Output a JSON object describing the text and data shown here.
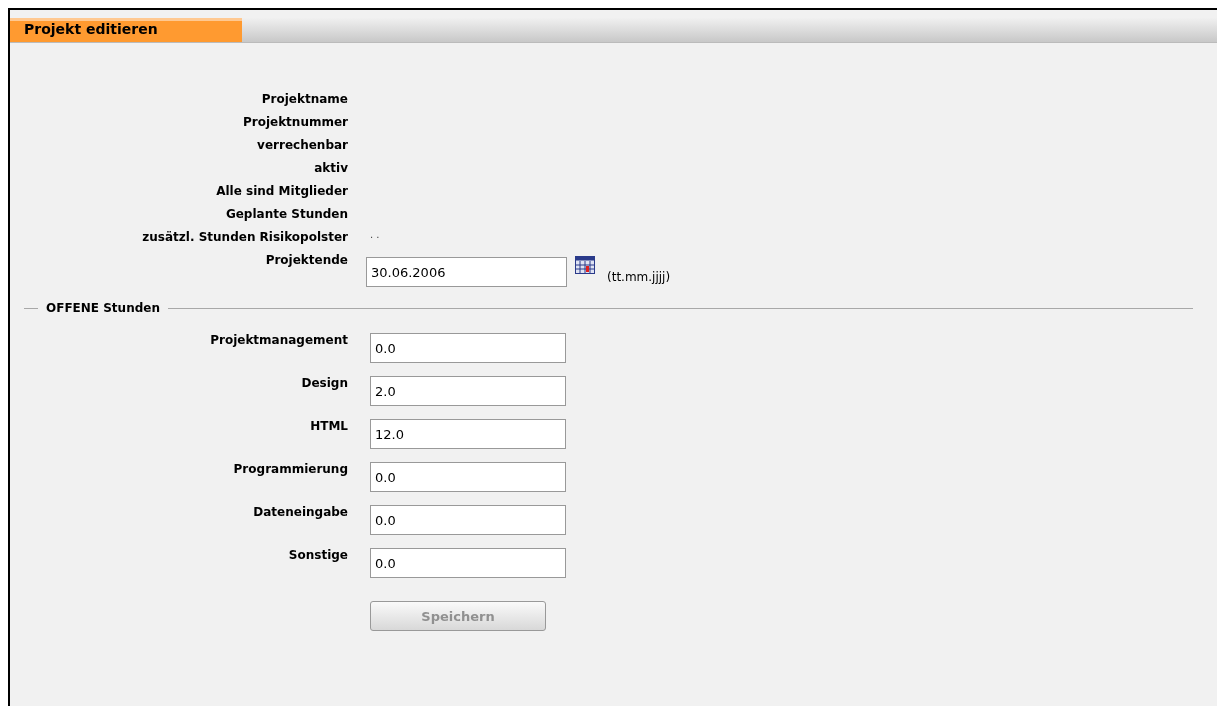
{
  "header": {
    "title": "Projekt editieren"
  },
  "fields": [
    {
      "label": "Projektname"
    },
    {
      "label": "Projektnummer"
    },
    {
      "label": "verrechenbar"
    },
    {
      "label": "aktiv"
    },
    {
      "label": "Alle sind Mitglieder"
    },
    {
      "label": "Geplante Stunden"
    },
    {
      "label": "zusätzl. Stunden Risikopolster",
      "value": ". ."
    },
    {
      "label": "Projektende",
      "kind": "date",
      "value": "30.06.2006",
      "hint": "(tt.mm.jjjj)"
    }
  ],
  "hours": {
    "legend": "OFFENE Stunden",
    "rows": [
      {
        "label": "Projektmanagement",
        "value": "0.0"
      },
      {
        "label": "Design",
        "value": "2.0"
      },
      {
        "label": "HTML",
        "value": "12.0"
      },
      {
        "label": "Programmierung",
        "value": "0.0"
      },
      {
        "label": "Dateneingabe",
        "value": "0.0"
      },
      {
        "label": "Sonstige",
        "value": "0.0"
      }
    ]
  },
  "save_button": {
    "label": "Speichern",
    "disabled": true
  }
}
